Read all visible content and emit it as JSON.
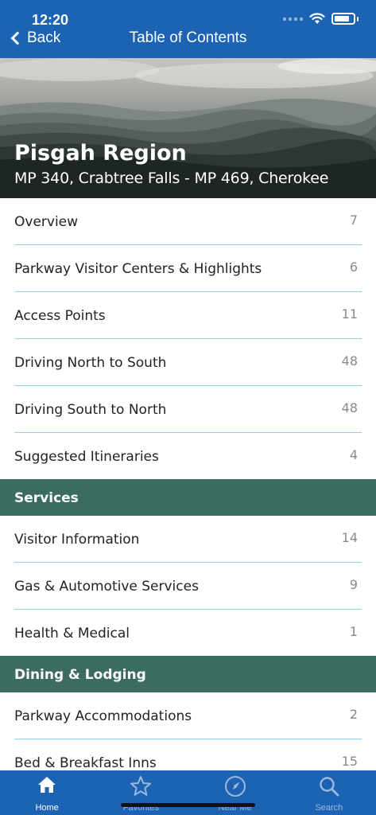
{
  "status": {
    "time": "12:20"
  },
  "nav": {
    "back_label": "Back",
    "title": "Table of Contents"
  },
  "hero": {
    "title": "Pisgah Region",
    "subtitle": "MP 340, Crabtree Falls - MP 469, Cherokee"
  },
  "toc": {
    "items": [
      {
        "label": "Overview",
        "count": "7"
      },
      {
        "label": "Parkway Visitor Centers & Highlights",
        "count": "6"
      },
      {
        "label": "Access Points",
        "count": "11"
      },
      {
        "label": "Driving North to South",
        "count": "48"
      },
      {
        "label": "Driving South to North",
        "count": "48"
      },
      {
        "label": "Suggested Itineraries",
        "count": "4"
      }
    ],
    "services_header": "Services",
    "services": [
      {
        "label": "Visitor Information",
        "count": "14"
      },
      {
        "label": "Gas & Automotive Services",
        "count": "9"
      },
      {
        "label": "Health & Medical",
        "count": "1"
      }
    ],
    "dining_header": "Dining & Lodging",
    "dining": [
      {
        "label": "Parkway Accommodations",
        "count": "2"
      },
      {
        "label": "Bed & Breakfast Inns",
        "count": "15"
      }
    ]
  },
  "tabs": [
    {
      "label": "Home",
      "icon": "home-icon",
      "active": true
    },
    {
      "label": "Favorites",
      "icon": "star-icon",
      "active": false
    },
    {
      "label": "Near Me",
      "icon": "compass-icon",
      "active": false
    },
    {
      "label": "Search",
      "icon": "search-icon",
      "active": false
    }
  ],
  "colors": {
    "brand_blue": "#1d63b3",
    "section_green": "#3c6b60",
    "divider": "#8fd3ee"
  }
}
